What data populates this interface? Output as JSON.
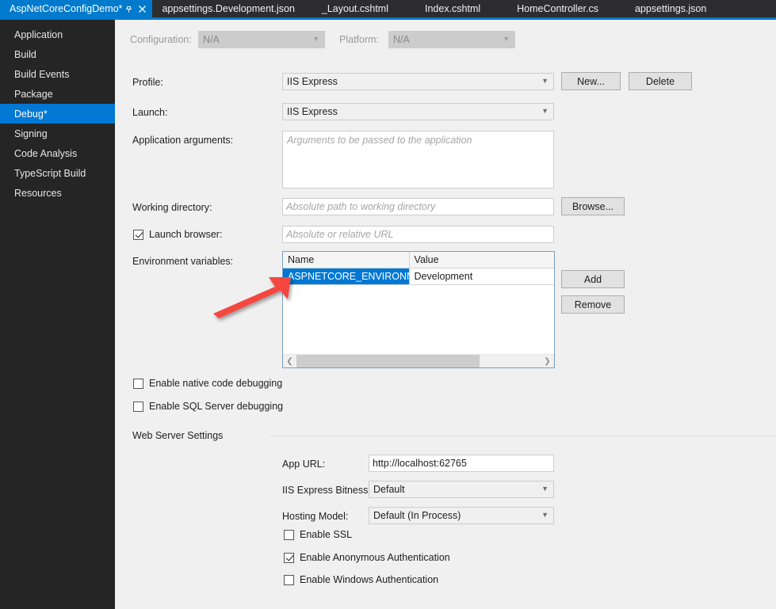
{
  "tabs": [
    {
      "label": "AspNetCoreConfigDemo*",
      "active": true,
      "pin_icon": "pin-icon",
      "close_icon": "close-icon"
    },
    {
      "label": "appsettings.Development.json",
      "active": false
    },
    {
      "label": "_Layout.cshtml",
      "active": false
    },
    {
      "label": "Index.cshtml",
      "active": false
    },
    {
      "label": "HomeController.cs",
      "active": false
    },
    {
      "label": "appsettings.json",
      "active": false
    }
  ],
  "sidebar": {
    "items": [
      {
        "label": "Application",
        "selected": false
      },
      {
        "label": "Build",
        "selected": false
      },
      {
        "label": "Build Events",
        "selected": false
      },
      {
        "label": "Package",
        "selected": false
      },
      {
        "label": "Debug*",
        "selected": true
      },
      {
        "label": "Signing",
        "selected": false
      },
      {
        "label": "Code Analysis",
        "selected": false
      },
      {
        "label": "TypeScript Build",
        "selected": false
      },
      {
        "label": "Resources",
        "selected": false
      }
    ]
  },
  "toolbar": {
    "configuration_label": "Configuration:",
    "configuration_value": "N/A",
    "platform_label": "Platform:",
    "platform_value": "N/A"
  },
  "debug": {
    "profile_label": "Profile:",
    "profile_value": "IIS Express",
    "new_button": "New...",
    "delete_button": "Delete",
    "launch_label": "Launch:",
    "launch_value": "IIS Express",
    "app_args_label": "Application arguments:",
    "app_args_value": "",
    "app_args_placeholder": "Arguments to be passed to the application",
    "working_dir_label": "Working directory:",
    "working_dir_value": "",
    "working_dir_placeholder": "Absolute path to working directory",
    "browse_button": "Browse...",
    "launch_browser_label": "Launch browser:",
    "launch_browser_checked": true,
    "launch_url_value": "",
    "launch_url_placeholder": "Absolute or relative URL",
    "env_vars_label": "Environment variables:",
    "env_table": {
      "columns": [
        "Name",
        "Value"
      ],
      "rows": [
        {
          "name": "ASPNETCORE_ENVIRONMENT",
          "value": "Development",
          "name_selected": true
        }
      ]
    },
    "add_button": "Add",
    "remove_button": "Remove",
    "native_debug_label": "Enable native code debugging",
    "native_debug_checked": false,
    "sql_debug_label": "Enable SQL Server debugging",
    "sql_debug_checked": false
  },
  "web_server": {
    "section_title": "Web Server Settings",
    "app_url_label": "App URL:",
    "app_url_value": "http://localhost:62765",
    "bitness_label": "IIS Express Bitness:",
    "bitness_value": "Default",
    "hosting_model_label": "Hosting Model:",
    "hosting_model_value": "Default (In Process)",
    "ssl_label": "Enable SSL",
    "ssl_checked": false,
    "anonymous_auth_label": "Enable Anonymous Authentication",
    "anonymous_auth_checked": true,
    "windows_auth_label": "Enable Windows Authentication",
    "windows_auth_checked": false
  },
  "annotation": {
    "type": "red-arrow",
    "color": "#f4473f",
    "points_to": "ASPNETCORE_ENVIRONMENT"
  },
  "colors": {
    "accent": "#007acc",
    "selection": "#0078d4",
    "tabstrip_bg": "#2d2d30",
    "sidebar_bg": "#252526",
    "content_bg": "#f0f0f0",
    "annotation_red": "#f4473f"
  }
}
